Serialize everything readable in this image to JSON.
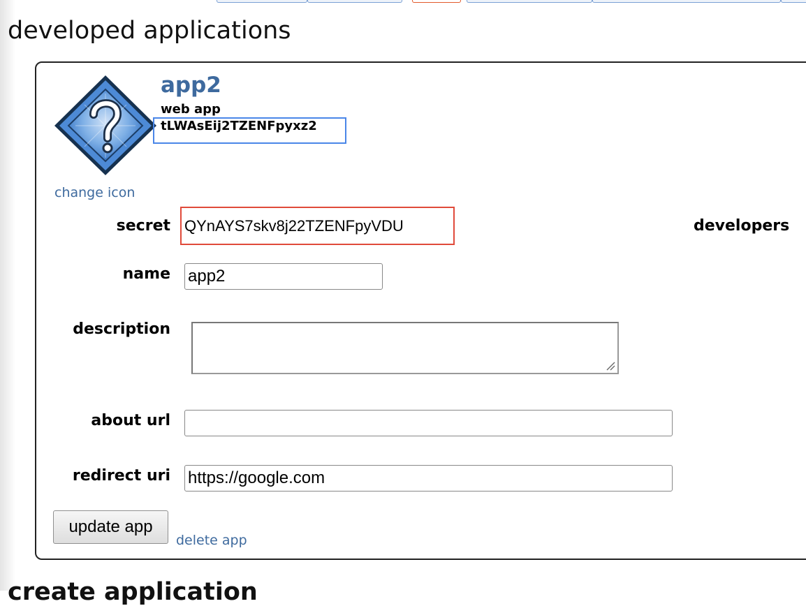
{
  "section": {
    "title": "developed applications",
    "next_title": "create application"
  },
  "app": {
    "title": "app2",
    "type": "web app",
    "client_id": "tLWAsEij2TZENFpyxz2",
    "icon": "question-mark-diamond-icon",
    "change_icon_label": "change icon"
  },
  "form": {
    "secret_label": "secret",
    "secret_value": "QYnAYS7skv8j22TZENFpyVDU",
    "developers_label": "developers",
    "name_label": "name",
    "name_value": "app2",
    "description_label": "description",
    "description_value": "",
    "about_url_label": "about url",
    "about_url_value": "",
    "redirect_uri_label": "redirect uri",
    "redirect_uri_value": "https://google.com",
    "update_label": "update app",
    "delete_label": "delete app"
  },
  "colors": {
    "link": "#3e6a9e",
    "client_id_highlight": "#4a86e8",
    "secret_highlight": "#e04a3a",
    "icon_blue": "#3a78c8"
  }
}
